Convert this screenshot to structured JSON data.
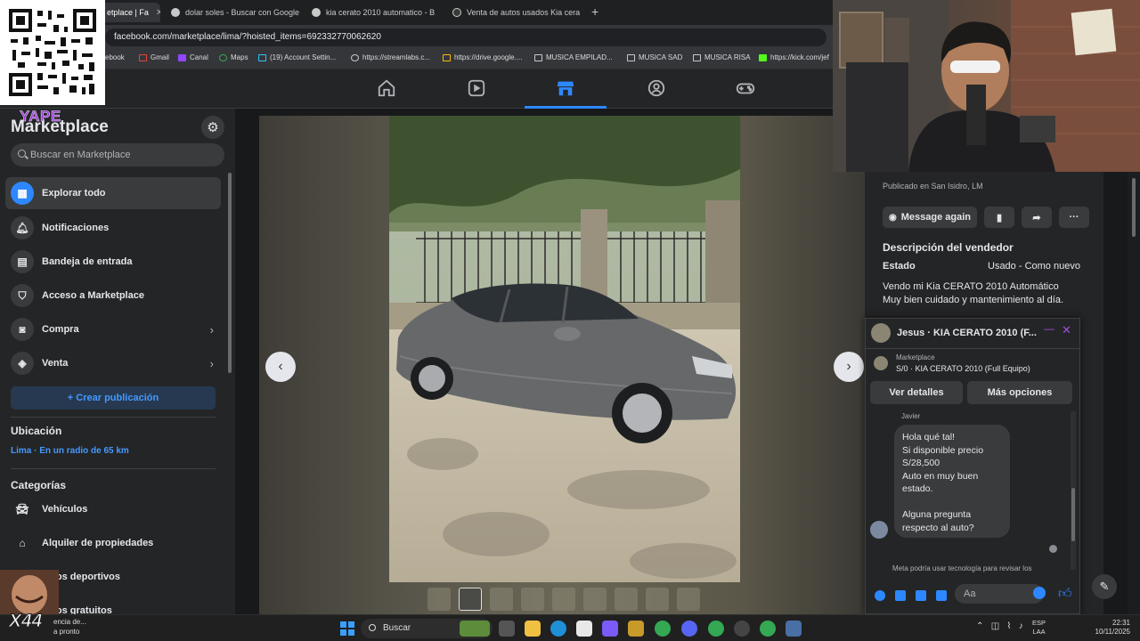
{
  "browser": {
    "tabs": [
      {
        "title": "etplace | Fa",
        "active": true
      },
      {
        "title": "dolar soles - Buscar con Google"
      },
      {
        "title": "kia cerato 2010 automatico - B"
      },
      {
        "title": "Venta de autos usados Kia cera"
      }
    ],
    "url": "facebook.com/marketplace/lima/?hoisted_items=692332770062620",
    "bookmarks": [
      "ebook",
      "Gmail",
      "Canal",
      "Maps",
      "(19) Account Settin...",
      "https://streamlabs.c...",
      "https://drive.google....",
      "MUSICA EMPILAD...",
      "MUSICA SAD",
      "MUSICA RISA",
      "https://kick.com/jef"
    ]
  },
  "fbnav": {
    "icons": [
      "home-icon",
      "video-icon",
      "marketplace-icon",
      "groups-icon",
      "gaming-icon"
    ],
    "active": "marketplace-icon"
  },
  "sidebar": {
    "title": "Marketplace",
    "search_placeholder": "Buscar en Marketplace",
    "items": [
      {
        "label": "Explorar todo",
        "icon": "storefront-icon",
        "active": true
      },
      {
        "label": "Notificaciones",
        "icon": "bell-icon"
      },
      {
        "label": "Bandeja de entrada",
        "icon": "inbox-icon"
      },
      {
        "label": "Acceso a Marketplace",
        "icon": "shield-icon"
      },
      {
        "label": "Compra",
        "icon": "shopping-bag-icon",
        "chevron": true
      },
      {
        "label": "Venta",
        "icon": "tag-icon",
        "chevron": true
      }
    ],
    "create_label": "+ Crear publicación",
    "location_heading": "Ubicación",
    "location_value": "Lima · En un radio de 65 km",
    "categories_heading": "Categorías",
    "categories": [
      {
        "label": "Vehículos",
        "icon": "car-icon"
      },
      {
        "label": "Alquiler de propiedades",
        "icon": "house-icon"
      },
      {
        "label": "culos deportivos",
        "icon": "car-icon"
      },
      {
        "label": "culos gratuitos",
        "icon": "tag-icon"
      }
    ]
  },
  "listing": {
    "published": "Publicado en San Isidro, LM",
    "message_again": "Message again",
    "seller_desc_heading": "Descripción del vendedor",
    "estado_label": "Estado",
    "estado_value": "Usado - Como nuevo",
    "description": [
      "Vendo mi Kia CERATO 2010 Automático",
      "Muy bien cuidado y mantenimiento al día."
    ]
  },
  "chat": {
    "title": "Jesus · KIA CERATO 2010 (F...",
    "marketplace_label": "Marketplace",
    "item": "S/0 · KIA CERATO 2010 (Full Equipo)",
    "view_details": "Ver detalles",
    "more_options": "Más opciones",
    "sender": "Javier",
    "message_lines": [
      "Hola qué tal!",
      "Si disponible precio",
      "S/28,500",
      "Auto en muy buen",
      "estado.",
      "",
      "Alguna pregunta",
      "respecto al auto?"
    ],
    "disclaimer": "Meta podría usar tecnología para revisar los",
    "input_placeholder": "Aa"
  },
  "taskbar": {
    "search": "Buscar",
    "lang_line1": "ESP",
    "lang_line2": "LAA",
    "time": "22:31",
    "date": "10/11/2025",
    "notif_line1": "encia de...",
    "notif_line2": "a pronto"
  },
  "overlays": {
    "yape_logo": "YAPE",
    "sticker_logo": "X44"
  },
  "colors": {
    "accent": "#2d88ff",
    "background": "#18191a",
    "panel": "#242526",
    "surface": "#3a3b3c",
    "yape": "#9b3fd8"
  }
}
